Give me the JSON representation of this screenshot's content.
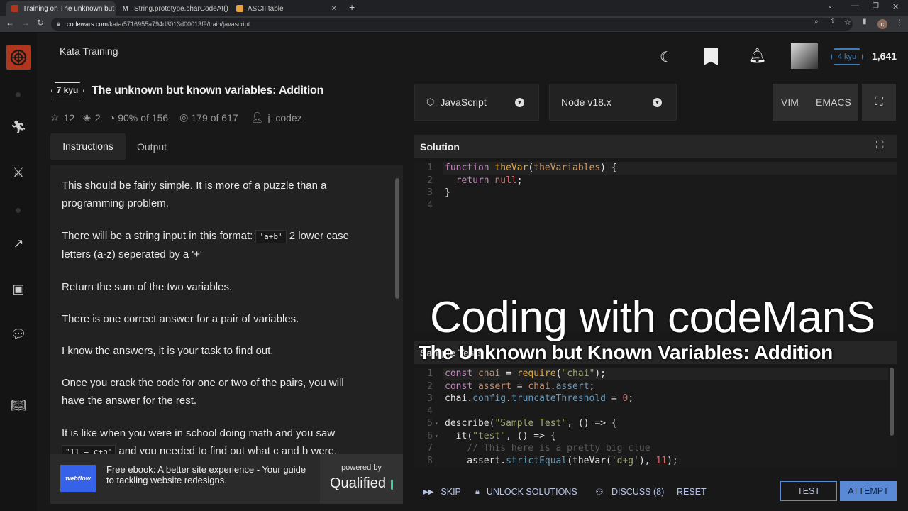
{
  "browser": {
    "tabs": [
      {
        "title": "Training on The unknown but kn",
        "active": true
      },
      {
        "title": "String.prototype.charCodeAt() - ",
        "active": false
      },
      {
        "title": "ASCII table",
        "active": false
      }
    ],
    "new_tab": "+",
    "url_domain": "codewars.com",
    "url_path": "/kata/5716955a794d3013d00013f9/train/javascript",
    "profile_initial": "c"
  },
  "header": {
    "title": "Kata Training"
  },
  "user": {
    "rank": "4 kyu",
    "honor": "1,641"
  },
  "kata": {
    "rank": "7 kyu",
    "title": "The unknown but known variables: Addition",
    "stars": "12",
    "collections": "2",
    "satisfaction_pct": "90%",
    "satisfaction_of": "of 156",
    "completions": "179",
    "completions_of": "of 617",
    "author": "j_codez"
  },
  "tabs": {
    "instructions": "Instructions",
    "output": "Output"
  },
  "instructions": {
    "p1": "This should be fairly simple. It is more of a puzzle than a programming problem.",
    "p2_before": "There will be a string input in this format: ",
    "p2_code": "'a+b'",
    "p2_after": " 2 lower case letters (a-z) seperated by a '+'",
    "p3": "Return the sum of the two variables.",
    "p4": "There is one correct answer for a pair of variables.",
    "p5": "I know the answers, it is your task to find out.",
    "p6": "Once you crack the code for one or two of the pairs, you will have the answer for the rest.",
    "p7_before": "It is like when you were in school doing math and you saw",
    "p7_code": "\"11 = c+b\"",
    "p7_after": " and you needed to find out what c and b were."
  },
  "ad": {
    "brand": "webflow",
    "text": "Free ebook: A better site experience - Your guide to tackling website redesigns.",
    "powered_by": "powered by",
    "qualified": "Qualified"
  },
  "editor": {
    "language": "JavaScript",
    "runtime": "Node v18.x",
    "vim": "VIM",
    "emacs": "EMACS",
    "solution_title": "Solution",
    "sample_tests_title": "Sample Tests"
  },
  "solution_code": {
    "l1_kw": "function",
    "l1_fn": "theVar",
    "l1_param": "theVariables",
    "l1_rest": ") {",
    "l2_kw": "return",
    "l2_val": "null",
    "l2_end": ";",
    "l3": "}",
    "lines": [
      "1",
      "2",
      "3",
      "4"
    ]
  },
  "test_code": {
    "lines": [
      "1",
      "2",
      "3",
      "4",
      "5",
      "6",
      "7",
      "8"
    ],
    "l1": [
      "const",
      " chai",
      " = ",
      "require",
      "(",
      "\"chai\"",
      ");"
    ],
    "l2": [
      "const",
      " assert",
      " = ",
      "chai",
      ".",
      "assert",
      ";"
    ],
    "l3": [
      "chai",
      ".",
      "config",
      ".",
      "truncateThreshold",
      " = ",
      "0",
      ";"
    ],
    "l5": [
      "describe",
      "(",
      "\"Sample Test\"",
      ", () => {"
    ],
    "l6": [
      "  it",
      "(",
      "\"test\"",
      ", () => {"
    ],
    "l7": "    // This here is a pretty big clue",
    "l8": [
      "    assert",
      ".",
      "strictEqual",
      "(theVar(",
      "'d+g'",
      "), ",
      "11",
      ");"
    ]
  },
  "overlay": {
    "line1": "Coding with codeManS",
    "line2": "The Unknown but Known Variables: Addition"
  },
  "actions": {
    "skip": "SKIP",
    "unlock": "UNLOCK SOLUTIONS",
    "discuss": "DISCUSS (8)",
    "reset": "RESET",
    "test": "TEST",
    "attempt": "ATTEMPT"
  },
  "colors": {
    "accent": "#b1361e",
    "rank_blue": "#3c7ebb",
    "attempt": "#5a8ad6"
  }
}
